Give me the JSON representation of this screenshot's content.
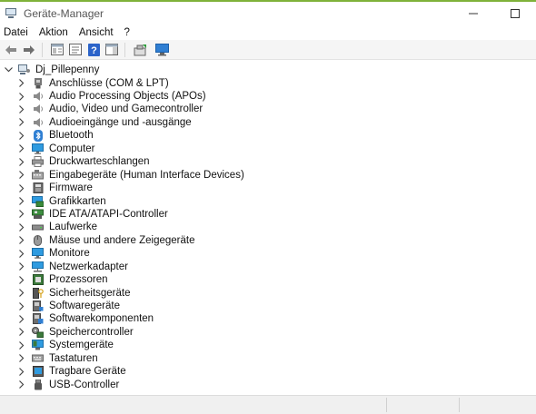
{
  "window": {
    "title": "Geräte-Manager",
    "minimize_glyph": "—",
    "maximize_glyph": "☐",
    "app_icon": "device-manager-icon"
  },
  "menu": [
    "Datei",
    "Aktion",
    "Ansicht",
    "?"
  ],
  "toolbar": {
    "icons": [
      "back-arrow-icon",
      "forward-arrow-icon",
      "show-hide-console-tree-icon",
      "properties-icon",
      "help-icon",
      "action-pane-icon",
      "update-driver-icon",
      "scan-hardware-changes-icon"
    ]
  },
  "tree": {
    "root": {
      "label": "Dj_Pillepenny",
      "expanded": true,
      "icon": "computer-user-icon"
    },
    "categories": [
      {
        "label": "Anschlüsse (COM & LPT)",
        "icon": "port-icon"
      },
      {
        "label": "Audio Processing Objects (APOs)",
        "icon": "speaker-icon"
      },
      {
        "label": "Audio, Video und Gamecontroller",
        "icon": "speaker-icon"
      },
      {
        "label": "Audioeingänge und -ausgänge",
        "icon": "speaker-icon"
      },
      {
        "label": "Bluetooth",
        "icon": "bluetooth-icon"
      },
      {
        "label": "Computer",
        "icon": "monitor-icon"
      },
      {
        "label": "Druckwarteschlangen",
        "icon": "printer-icon"
      },
      {
        "label": "Eingabegeräte (Human Interface Devices)",
        "icon": "keyboard-hid-icon"
      },
      {
        "label": "Firmware",
        "icon": "firmware-chip-icon"
      },
      {
        "label": "Grafikkarten",
        "icon": "display-adapter-icon"
      },
      {
        "label": "IDE ATA/ATAPI-Controller",
        "icon": "ide-controller-icon"
      },
      {
        "label": "Laufwerke",
        "icon": "disk-drive-icon"
      },
      {
        "label": "Mäuse und andere Zeigegeräte",
        "icon": "mouse-icon"
      },
      {
        "label": "Monitore",
        "icon": "monitor-icon"
      },
      {
        "label": "Netzwerkadapter",
        "icon": "network-adapter-icon"
      },
      {
        "label": "Prozessoren",
        "icon": "processor-icon"
      },
      {
        "label": "Sicherheitsgeräte",
        "icon": "security-key-icon"
      },
      {
        "label": "Softwaregeräte",
        "icon": "software-device-icon"
      },
      {
        "label": "Softwarekomponenten",
        "icon": "software-component-icon"
      },
      {
        "label": "Speichercontroller",
        "icon": "storage-controller-icon"
      },
      {
        "label": "Systemgeräte",
        "icon": "system-device-icon"
      },
      {
        "label": "Tastaturen",
        "icon": "keyboard-icon"
      },
      {
        "label": "Tragbare Geräte",
        "icon": "portable-device-icon"
      },
      {
        "label": "USB-Controller",
        "icon": "usb-icon"
      }
    ]
  },
  "colors": {
    "accent_top": "#7fb23a",
    "icon_blue": "#2f7fd3",
    "help_blue": "#2b63c9"
  }
}
